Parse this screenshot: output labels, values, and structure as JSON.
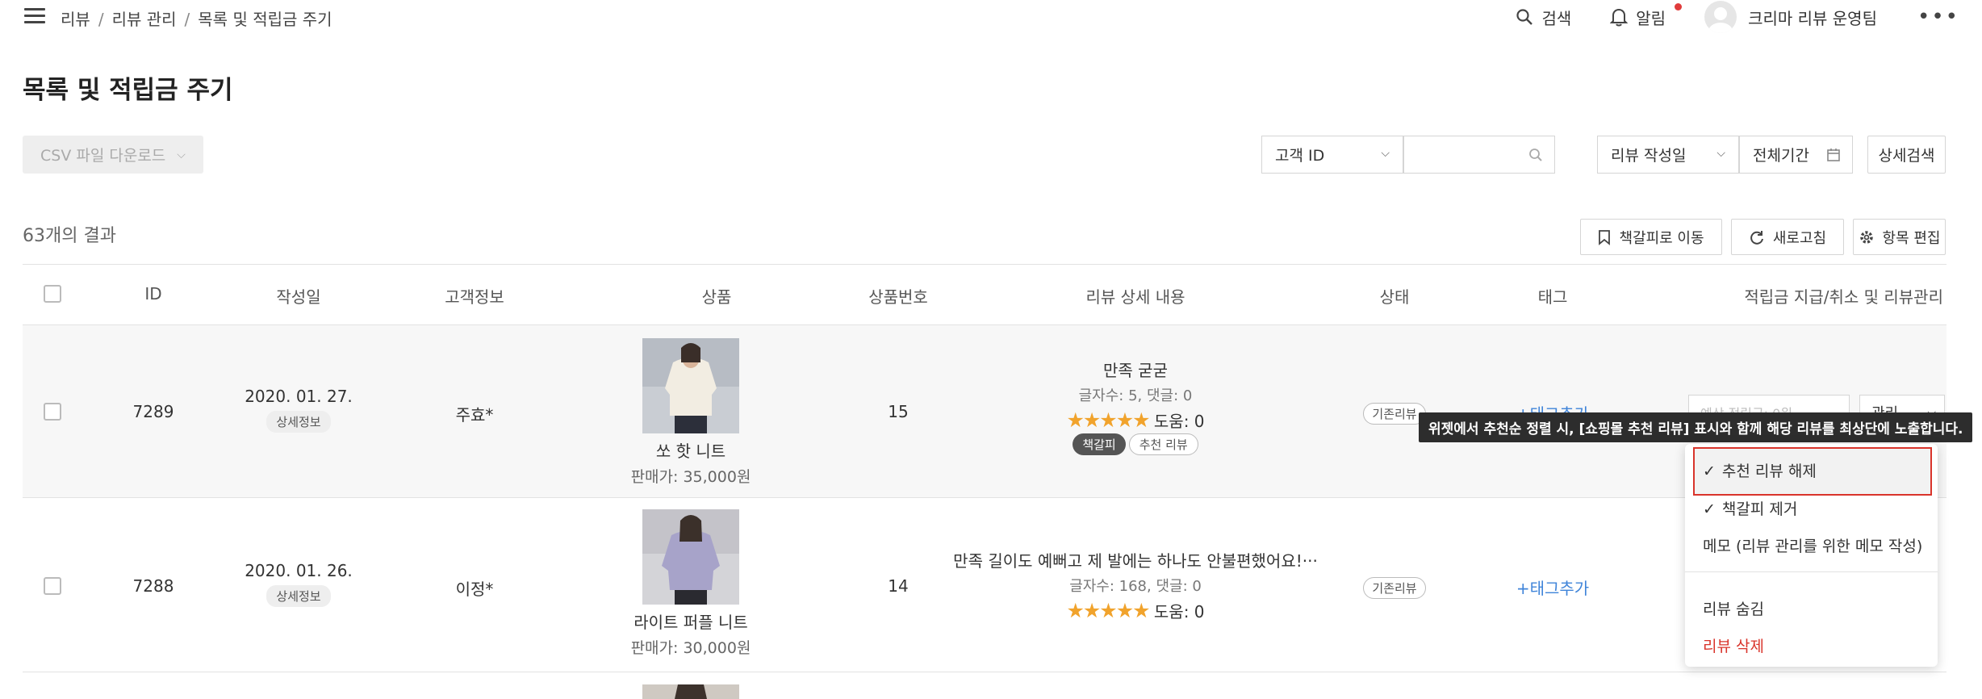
{
  "nav": {
    "breadcrumb": [
      "리뷰",
      "리뷰 관리",
      "목록 및 적립금 주기"
    ],
    "search_label": "검색",
    "alerts_label": "알림",
    "user_name": "크리마 리뷰 운영팀"
  },
  "page": {
    "title": "목록 및 적립금 주기"
  },
  "toolbar": {
    "csv_label": "CSV 파일 다운로드",
    "customer_filter": "고객 ID",
    "search_placeholder": "",
    "date_filter": "리뷰 작성일",
    "period_label": "전체기간",
    "advanced_search": "상세검색"
  },
  "results": {
    "count_label": "63개의 결과",
    "bookmark_btn": "책갈피로 이동",
    "refresh_btn": "새로고침",
    "edit_columns_btn": "항목 편집"
  },
  "table": {
    "headers": [
      "ID",
      "작성일",
      "고객정보",
      "상품",
      "상품번호",
      "리뷰 상세 내용",
      "상태",
      "태그",
      "적립금 지급/취소 및 리뷰관리"
    ],
    "rows": [
      {
        "id": "7289",
        "date": "2020. 01. 27.",
        "detail_badge": "상세정보",
        "customer": "주효*",
        "product_name": "쏘 핫 니트",
        "price": "판매가: 35,000원",
        "product_no": "15",
        "review_title": "만족 굳굳",
        "review_meta": "글자수: 5, 댓글: 0",
        "help": "도움: 0",
        "tags": [
          "책갈피",
          "추천 리뷰"
        ],
        "status": "기존리뷰",
        "tag_add": "+태그추가",
        "reward_placeholder": "예상 적립금: 0원",
        "manage": "관리"
      },
      {
        "id": "7288",
        "date": "2020. 01. 26.",
        "detail_badge": "상세정보",
        "customer": "이정*",
        "product_name": "라이트 퍼플 니트",
        "price": "판매가: 30,000원",
        "product_no": "14",
        "review_title": "만족 길이도 예뻐고 제 발에는 하나도 안불편했어요!···",
        "review_meta": "글자수: 168, 댓글: 0",
        "help": "도움: 0",
        "status": "기존리뷰",
        "tag_add": "+태그추가"
      }
    ]
  },
  "tooltip": "위젯에서 추천순 정렬 시, [쇼핑몰 추천 리뷰] 표시와 함께 해당 리뷰를 최상단에 노출합니다.",
  "menu": {
    "items": [
      "추천 리뷰 해제",
      "책갈피 제거",
      "메모 (리뷰 관리를 위한 메모 작성)",
      "리뷰 숨김",
      "리뷰 삭제"
    ]
  },
  "colors": {
    "accent_link": "#3f84d9",
    "star": "#f1a32c",
    "danger": "#d9342b",
    "notification_dot": "#e03b3b"
  }
}
